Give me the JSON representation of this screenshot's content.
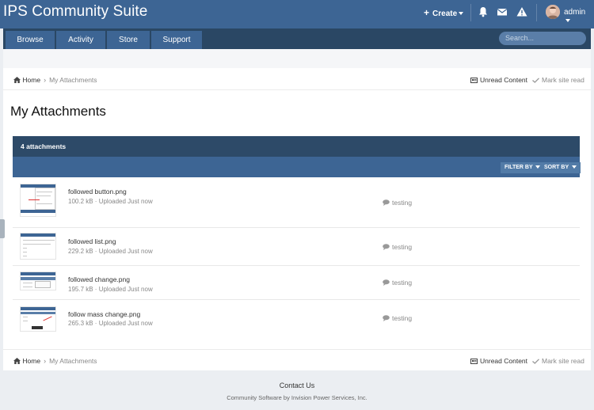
{
  "header": {
    "site_title": "IPS Community Suite",
    "create_label": "Create",
    "user_name": "admin",
    "icons": [
      "bell-icon",
      "envelope-icon",
      "warning-icon"
    ]
  },
  "nav": {
    "tabs": [
      {
        "label": "Browse"
      },
      {
        "label": "Activity"
      },
      {
        "label": "Store"
      },
      {
        "label": "Support"
      }
    ],
    "search_placeholder": "Search..."
  },
  "breadcrumb": {
    "home": "Home",
    "current": "My Attachments",
    "unread": "Unread Content",
    "mark_read": "Mark site read"
  },
  "page": {
    "title": "My Attachments",
    "count_label": "4 attachments",
    "filter_label": "FILTER BY",
    "sort_label": "SORT BY"
  },
  "attachments": [
    {
      "name": "followed button.png",
      "meta": "100.2 kB · Uploaded Just now",
      "tag": "testing"
    },
    {
      "name": "followed list.png",
      "meta": "229.2 kB · Uploaded Just now",
      "tag": "testing"
    },
    {
      "name": "followed change.png",
      "meta": "195.7 kB · Uploaded Just now",
      "tag": "testing"
    },
    {
      "name": "follow mass change.png",
      "meta": "265.3 kB · Uploaded Just now",
      "tag": "testing"
    }
  ],
  "footer": {
    "contact": "Contact Us",
    "copyright": "Community Software by Invision Power Services, Inc."
  },
  "colors": {
    "header": "#3d6594",
    "nav": "#2a4764",
    "panel_head": "#2d4a68"
  }
}
